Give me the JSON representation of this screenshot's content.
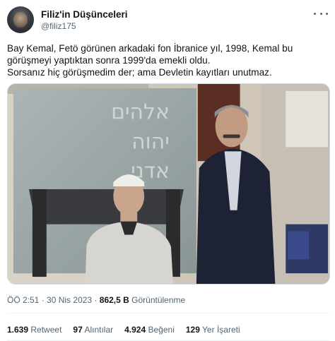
{
  "author": {
    "display_name": "Filiz'in Düşünceleri",
    "handle": "@filiz175"
  },
  "tweet": {
    "lines": [
      "Bay Kemal, Fetö görünen arkadaki fon İbranice yıl, 1998, Kemal bu",
      "görüşmeyi yaptıktan sonra 1999'da emekli oldu.",
      "Sorsanız hiç görüşmedim der; ama Devletin kayıtları unutmaz."
    ]
  },
  "media": {
    "wall_inscription": [
      "אלהים",
      "יהוה",
      "אדני"
    ]
  },
  "meta": {
    "time": "ÖÖ 2:51",
    "separator": "·",
    "date": "30 Nis 2023",
    "views_count": "862,5 B",
    "views_label": "Görüntülenme"
  },
  "stats": {
    "retweets": "1.639",
    "retweets_label": "Retweet",
    "quotes": "97",
    "quotes_label": "Alıntılar",
    "likes": "4.924",
    "likes_label": "Beğeni",
    "bookmarks": "129",
    "bookmarks_label": "Yer İşareti"
  }
}
